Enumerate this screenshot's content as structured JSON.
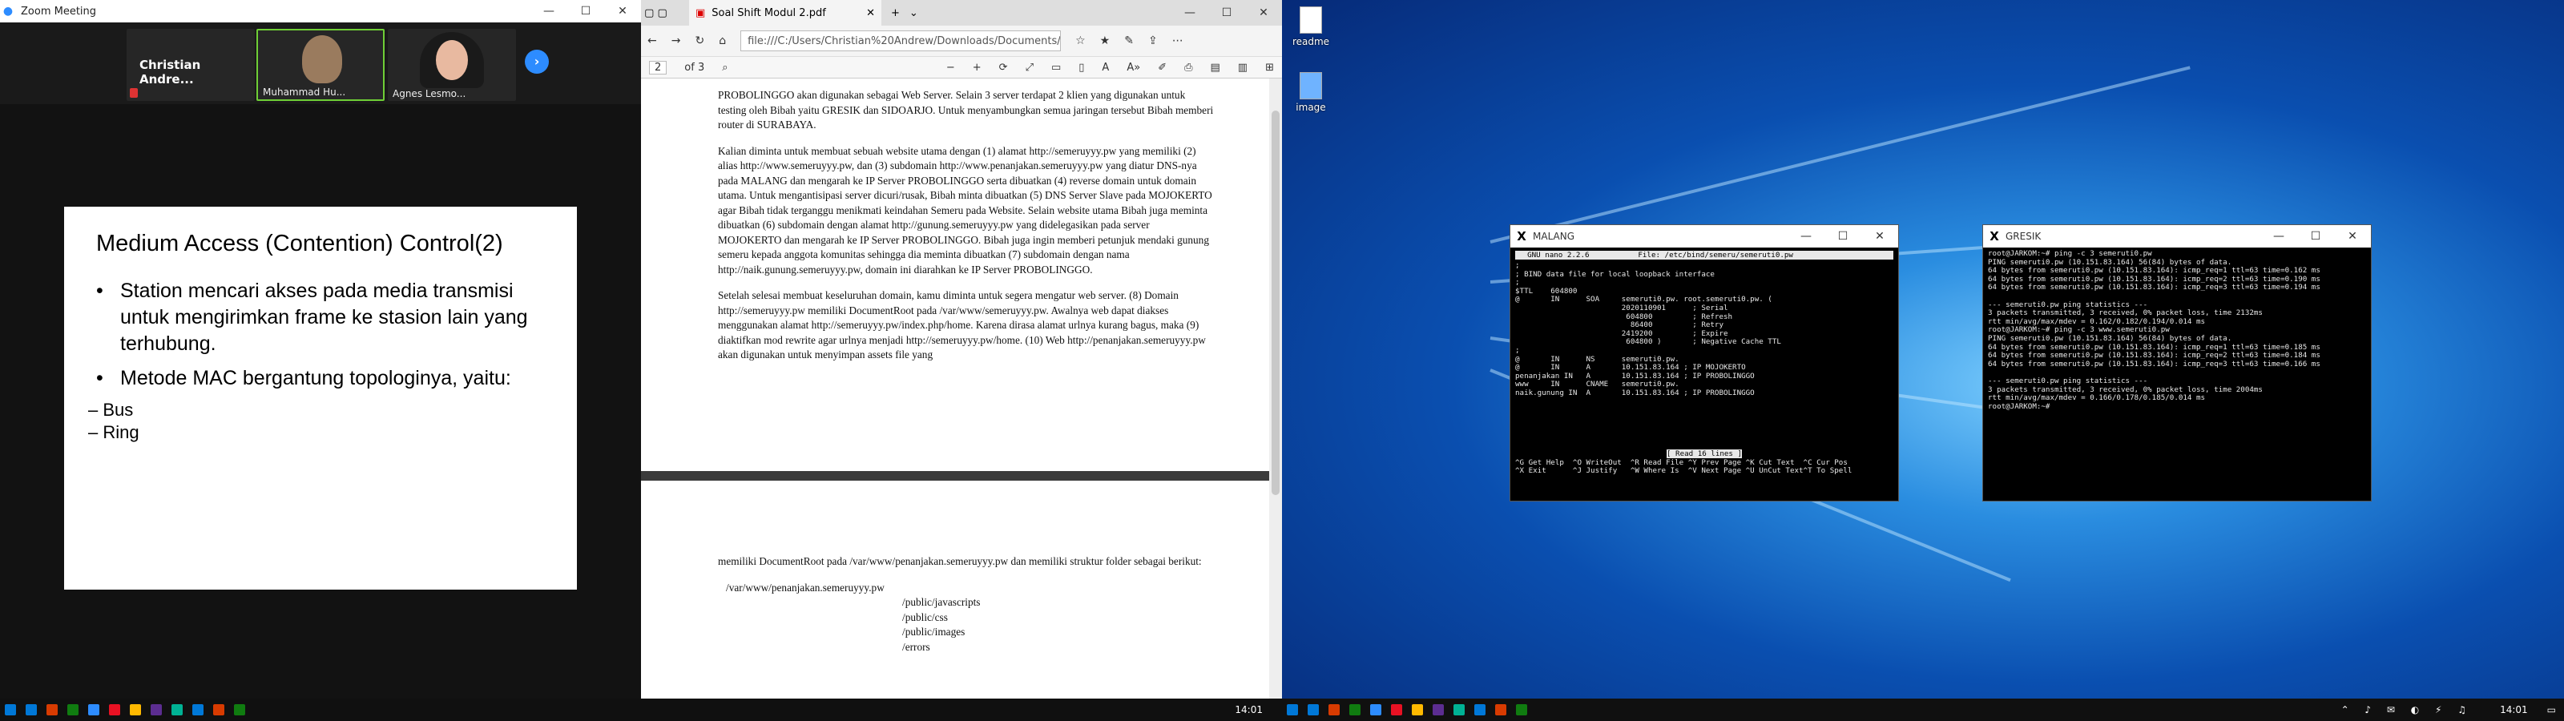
{
  "zoom": {
    "title": "Zoom Meeting",
    "participants": [
      "Christian  Andre...",
      "Muhammad  Hu...",
      "Agnes Lesmo..."
    ],
    "slide": {
      "title": "Medium Access (Contention) Control(2)",
      "bullet1": "Station mencari akses pada media transmisi untuk mengirimkan frame ke stasion lain yang terhubung.",
      "bullet2": " Metode MAC bergantung topologinya, yaitu:",
      "sub1": "– Bus",
      "sub2": "– Ring"
    }
  },
  "pdf": {
    "tab_title": "Soal Shift Modul 2.pdf",
    "url": "file:///C:/Users/Christian%20Andrew/Downloads/Documents/Soal",
    "page_current": "2",
    "page_total": "of 3",
    "para0": "PROBOLINGGO akan digunakan sebagai Web Server. Selain 3 server terdapat 2 klien yang digunakan untuk testing oleh Bibah yaitu GRESIK dan SIDOARJO. Untuk menyambungkan semua jaringan tersebut Bibah memberi router di SURABAYA.",
    "para1": "Kalian diminta untuk membuat sebuah website utama dengan (1) alamat http://semeruyyy.pw yang memiliki (2) alias http://www.semeruyyy.pw, dan (3) subdomain http://www.penanjakan.semeruyyy.pw yang diatur DNS-nya pada MALANG dan mengarah ke IP Server PROBOLINGGO serta dibuatkan (4) reverse domain untuk domain utama. Untuk mengantisipasi server dicuri/rusak, Bibah minta dibuatkan (5) DNS Server Slave pada MOJOKERTO agar Bibah tidak terganggu menikmati keindahan Semeru pada Website. Selain website utama Bibah juga meminta dibuatkan (6) subdomain dengan alamat http://gunung.semeruyyy.pw yang didelegasikan pada server MOJOKERTO dan mengarah ke IP Server PROBOLINGGO. Bibah juga ingin memberi petunjuk mendaki gunung semeru kepada anggota komunitas sehingga dia meminta dibuatkan (7) subdomain dengan nama http://naik.gunung.semeruyyy.pw, domain ini diarahkan ke IP Server PROBOLINGGO.",
    "para2": "Setelah selesai membuat keseluruhan domain, kamu diminta untuk segera mengatur web server. (8) Domain http://semeruyyy.pw memiliki DocumentRoot pada /var/www/semeruyyy.pw. Awalnya web dapat diakses menggunakan alamat http://semeruyyy.pw/index.php/home. Karena dirasa alamat urlnya kurang bagus, maka (9) diaktifkan mod rewrite agar urlnya menjadi http://semeruyyy.pw/home. (10) Web http://penanjakan.semeruyyy.pw akan digunakan untuk menyimpan assets file yang",
    "para3": "memiliki DocumentRoot pada /var/www/penanjakan.semeruyyy.pw dan memiliki struktur folder sebagai berikut:",
    "tree_root": "/var/www/penanjakan.semeruyyy.pw",
    "tree": [
      "/public/javascripts",
      "/public/css",
      "/public/images",
      "/errors"
    ]
  },
  "desktop": {
    "icons": [
      "readme",
      "image"
    ],
    "malang": {
      "title": "MALANG",
      "header": "  GNU nano 2.2.6           File: /etc/bind/semeru/semeruti0.pw",
      "body": ";\n; BIND data file for local loopback interface\n;\n$TTL    604800\n@       IN      SOA     semeruti0.pw. root.semeruti0.pw. (\n                        2020110901      ; Serial\n                         604800         ; Refresh\n                          86400         ; Retry\n                        2419200         ; Expire\n                         604800 )       ; Negative Cache TTL\n;\n@       IN      NS      semeruti0.pw.\n@       IN      A       10.151.83.164 ; IP MOJOKERTO\npenanjakan IN   A       10.151.83.164 ; IP PROBOLINGGO\nwww     IN      CNAME   semeruti0.pw.\nnaik.gunung IN  A       10.151.83.164 ; IP PROBOLINGGO",
      "status": "[ Read 16 lines ]",
      "keys1": "^G Get Help  ^O WriteOut  ^R Read File ^Y Prev Page ^K Cut Text  ^C Cur Pos",
      "keys2": "^X Exit      ^J Justify   ^W Where Is  ^V Next Page ^U UnCut Text^T To Spell"
    },
    "gresik": {
      "title": "GRESIK",
      "body": "root@JARKOM:~# ping -c 3 semeruti0.pw\nPING semeruti0.pw (10.151.83.164) 56(84) bytes of data.\n64 bytes from semeruti0.pw (10.151.83.164): icmp_req=1 ttl=63 time=0.162 ms\n64 bytes from semeruti0.pw (10.151.83.164): icmp_req=2 ttl=63 time=0.190 ms\n64 bytes from semeruti0.pw (10.151.83.164): icmp_req=3 ttl=63 time=0.194 ms\n\n--- semeruti0.pw ping statistics ---\n3 packets transmitted, 3 received, 0% packet loss, time 2132ms\nrtt min/avg/max/mdev = 0.162/0.182/0.194/0.014 ms\nroot@JARKOM:~# ping -c 3 www.semeruti0.pw\nPING semeruti0.pw (10.151.83.164) 56(84) bytes of data.\n64 bytes from semeruti0.pw (10.151.83.164): icmp_req=1 ttl=63 time=0.185 ms\n64 bytes from semeruti0.pw (10.151.83.164): icmp_req=2 ttl=63 time=0.184 ms\n64 bytes from semeruti0.pw (10.151.83.164): icmp_req=3 ttl=63 time=0.166 ms\n\n--- semeruti0.pw ping statistics ---\n3 packets transmitted, 3 received, 0% packet loss, time 2004ms\nrtt min/avg/max/mdev = 0.166/0.178/0.185/0.014 ms\nroot@JARKOM:~# "
    }
  },
  "taskbar": {
    "time": "14:01"
  },
  "colors": [
    "#0078d7",
    "#d83b01",
    "#107c10",
    "#2d8cff",
    "#e81123",
    "#ffb900",
    "#5c2d91",
    "#00b294"
  ]
}
